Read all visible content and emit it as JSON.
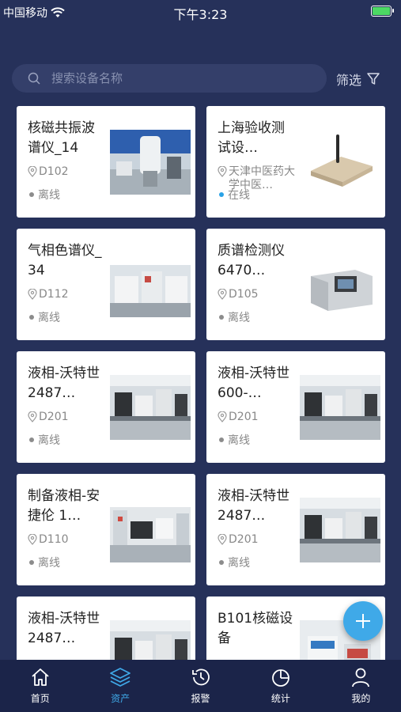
{
  "status_bar": {
    "carrier": "中国移动",
    "time": "下午3:23",
    "battery_level": 1.0
  },
  "search": {
    "placeholder": "搜索设备名称",
    "value": ""
  },
  "filter": {
    "label": "筛选"
  },
  "colors": {
    "accent": "#3fa9e8",
    "background": "#26315a",
    "tab_bar": "#1b2449",
    "online": "#2aa2e6",
    "offline": "#8c8c8c"
  },
  "devices": [
    {
      "name": "核磁共振波谱仪_14",
      "location": "D102",
      "status": "离线",
      "online": false,
      "image": "nmr-lab"
    },
    {
      "name": "上海验收测试设…",
      "location": "天津中医药大学中医…",
      "status": "在线",
      "online": true,
      "image": "router-device"
    },
    {
      "name": "气相色谱仪_34",
      "location": "D112",
      "status": "离线",
      "online": false,
      "image": "gc-lab"
    },
    {
      "name": "质谱检测仪 6470…",
      "location": "D105",
      "status": "离线",
      "online": false,
      "image": "mass-spectrometer"
    },
    {
      "name": "液相-沃特世 2487…",
      "location": "D201",
      "status": "离线",
      "online": false,
      "image": "hplc-lab"
    },
    {
      "name": "液相-沃特世 600-…",
      "location": "D201",
      "status": "离线",
      "online": false,
      "image": "hplc-lab"
    },
    {
      "name": "制备液相-安捷伦 1…",
      "location": "D110",
      "status": "离线",
      "online": false,
      "image": "prep-lab"
    },
    {
      "name": "液相-沃特世 2487…",
      "location": "D201",
      "status": "离线",
      "online": false,
      "image": "hplc-lab"
    },
    {
      "name": "液相-沃特世 2487…",
      "location": "",
      "status": "",
      "online": false,
      "image": "hplc-lab"
    },
    {
      "name": "B101核磁设备",
      "location": "",
      "status": "",
      "online": false,
      "image": "nmr-device"
    }
  ],
  "tabs": [
    {
      "label": "首页",
      "icon": "home-icon",
      "active": false
    },
    {
      "label": "资产",
      "icon": "layers-icon",
      "active": true
    },
    {
      "label": "报警",
      "icon": "history-icon",
      "active": false
    },
    {
      "label": "统计",
      "icon": "pie-chart-icon",
      "active": false
    },
    {
      "label": "我的",
      "icon": "user-icon",
      "active": false
    }
  ]
}
